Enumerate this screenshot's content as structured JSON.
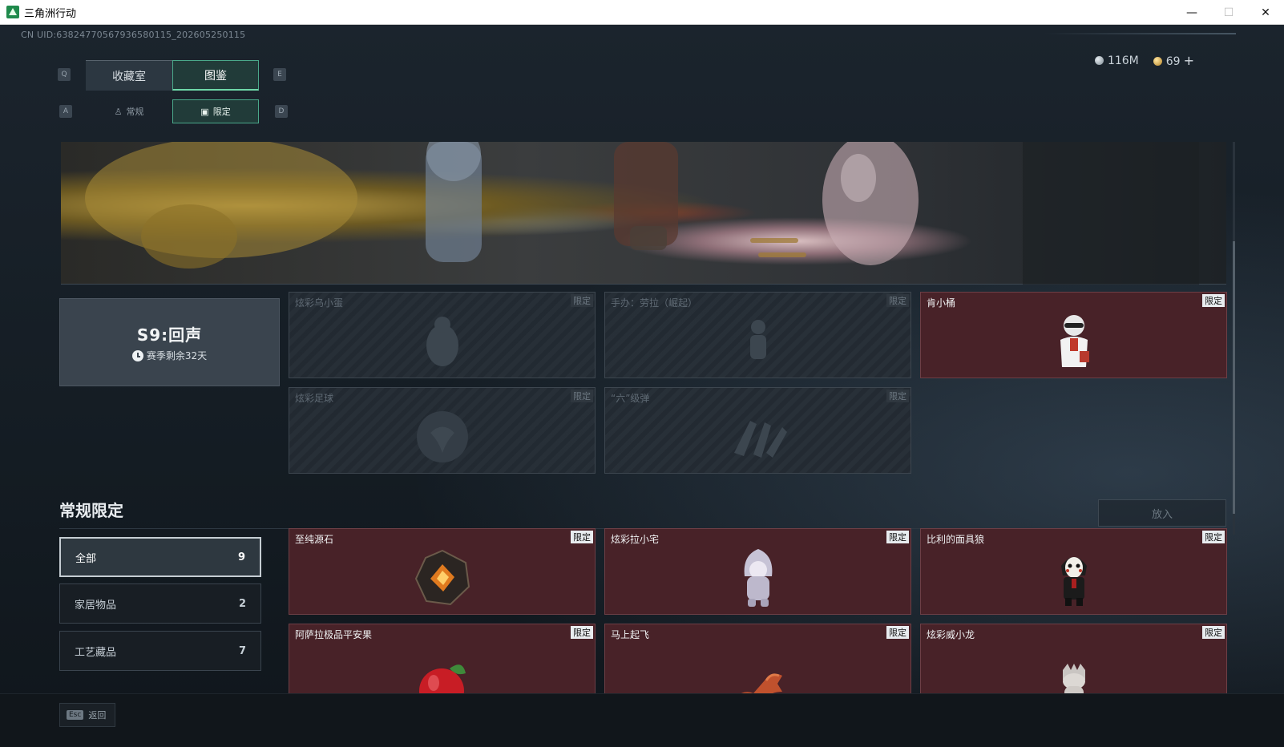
{
  "window": {
    "title": "三角洲行动",
    "minimize": "—",
    "maximize": "☐",
    "close": "✕"
  },
  "uid": "CN UID:6382477056793658011​5_202605250115",
  "currency": {
    "silver": "116M",
    "gold": "69",
    "add": "+"
  },
  "keys": {
    "prev_tab": "Q",
    "next_tab": "E",
    "prev_sub": "A",
    "next_sub": "D"
  },
  "tabs": [
    "收藏室",
    "图鉴"
  ],
  "subtabs": [
    "常规",
    "限定"
  ],
  "season": {
    "title": "S9:回声",
    "remaining": "赛季剩余32天"
  },
  "badge": "限定",
  "season_items": [
    {
      "name": "炫彩乌小蛋",
      "owned": false
    },
    {
      "name": "手办：劳拉（崛起）",
      "owned": false
    },
    {
      "name": "肯小桶",
      "owned": true
    },
    {
      "name": "炫彩足球",
      "owned": false
    },
    {
      "name": "“六”级弹",
      "owned": false
    }
  ],
  "section": {
    "title": "常规限定",
    "place_button": "放入"
  },
  "filters": [
    {
      "label": "全部",
      "count": "9"
    },
    {
      "label": "家居物品",
      "count": "2"
    },
    {
      "label": "工艺藏品",
      "count": "7"
    }
  ],
  "regular_items": [
    {
      "name": "至纯源石"
    },
    {
      "name": "炫彩拉小宅"
    },
    {
      "name": "比利的面具狼"
    },
    {
      "name": "阿萨拉极品平安果"
    },
    {
      "name": "马上起飞"
    },
    {
      "name": "炫彩威小龙"
    }
  ],
  "bottom": {
    "esc": "Esc",
    "back": "返回"
  },
  "colors": {
    "accent": "#4aa88a",
    "owned_card": "#482228",
    "badge_bg": "#e8ecef"
  }
}
